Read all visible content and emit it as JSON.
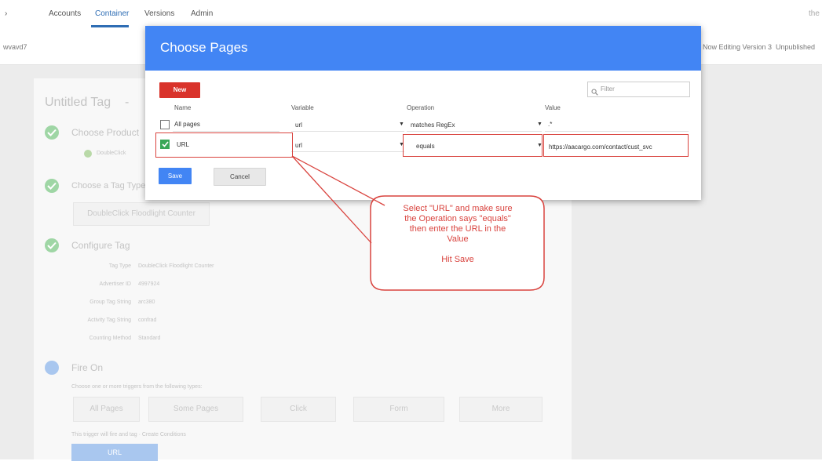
{
  "nav": {
    "left_glyph": "›",
    "tabs": [
      "Accounts",
      "Container",
      "Versions",
      "Admin"
    ],
    "active_tab": "Container",
    "right_text": "the"
  },
  "subbar": {
    "left_text": "wvavd7",
    "version_text": "Now Editing Version 3",
    "unpublished_text": "Unpublished"
  },
  "background": {
    "tag_title": "Untitled Tag",
    "steps": {
      "choose_product": "Choose Product",
      "product_item": "DoubleClick",
      "choose_tag_type": "Choose a Tag Type",
      "tag_type_value": "DoubleClick Floodlight Counter",
      "configure_tag": "Configure Tag",
      "fire_on": "Fire On"
    },
    "config_rows": [
      {
        "label": "Tag Type",
        "value": "DoubleClick Floodlight Counter"
      },
      {
        "label": "Advertiser ID",
        "value": "4997924"
      },
      {
        "label": "Group Tag String",
        "value": "arc380"
      },
      {
        "label": "Activity Tag String",
        "value": "confrad"
      },
      {
        "label": "Counting Method",
        "value": "Standard"
      }
    ],
    "fire_on_hint": "Choose one or more triggers from the following types:",
    "trigger_types": [
      "All Pages",
      "Some Pages",
      "Click",
      "Form",
      "More"
    ],
    "trigger_note": "This trigger will fire and tag · Create Conditions",
    "bottom_button": "URL"
  },
  "dialog": {
    "title": "Choose Pages",
    "new_label": "New",
    "filter_placeholder": "Filter",
    "columns": [
      "Name",
      "Variable",
      "Operation",
      "Value"
    ],
    "rows": [
      {
        "checked": false,
        "name": "All pages",
        "variable": "url",
        "operation": "matches RegEx",
        "value": ".*"
      },
      {
        "checked": true,
        "name": "URL",
        "variable": "url",
        "operation": "equals",
        "value": "https://aacargo.com/contact/cust_svc"
      }
    ],
    "save_label": "Save",
    "cancel_label": "Cancel"
  },
  "callout": {
    "line1": "Select \"URL\" and make sure",
    "line2": "the Operation says \"equals\"",
    "line3": "then enter the URL in the",
    "line4": "Value",
    "line5": "Hit Save",
    "color": "#d9433e"
  },
  "colors": {
    "primary": "#4285f4",
    "danger": "#d9332b",
    "success": "#3aa757"
  },
  "icons": {
    "search": "search-icon",
    "check": "check-icon",
    "dropdown": "dropdown-arrow-icon"
  }
}
